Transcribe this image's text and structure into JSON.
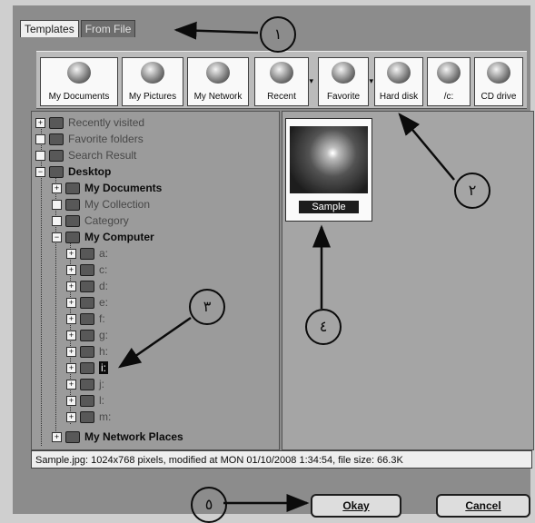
{
  "tabs": [
    {
      "label": "Templates"
    },
    {
      "label": "From File"
    }
  ],
  "toolbar": [
    {
      "label": "My Documents",
      "icon": "folder-documents-icon"
    },
    {
      "label": "My Pictures",
      "icon": "folder-pictures-icon"
    },
    {
      "label": "My Network",
      "icon": "network-icon"
    },
    {
      "label": "Recent",
      "icon": "recent-icon",
      "dropdown": "▾"
    },
    {
      "label": "Favorite",
      "icon": "favorite-icon",
      "dropdown": "▾"
    },
    {
      "label": "Hard disk",
      "icon": "hard-disk-icon"
    },
    {
      "label": "/c:",
      "icon": "drive-icon"
    },
    {
      "label": "CD drive",
      "icon": "cd-drive-icon"
    }
  ],
  "tree": [
    {
      "label": "Recently visited",
      "expander": "+",
      "style": "dim"
    },
    {
      "label": "Favorite folders",
      "expander": "",
      "style": "dim"
    },
    {
      "label": "Search Result",
      "expander": "",
      "style": "dim"
    },
    {
      "label": "Desktop",
      "expander": "−",
      "style": "bold"
    },
    {
      "label": "My Documents",
      "expander": "+",
      "style": "bold"
    },
    {
      "label": "My Collection",
      "expander": "",
      "style": "dim"
    },
    {
      "label": "Category",
      "expander": "",
      "style": "dim"
    },
    {
      "label": "My Computer",
      "expander": "−",
      "style": "bold"
    },
    {
      "label": "a:",
      "expander": "+",
      "style": "dim"
    },
    {
      "label": "c:",
      "expander": "+",
      "style": "dim"
    },
    {
      "label": "d:",
      "expander": "+",
      "style": "dim"
    },
    {
      "label": "e:",
      "expander": "+",
      "style": "dim"
    },
    {
      "label": "f:",
      "expander": "+",
      "style": "dim"
    },
    {
      "label": "g:",
      "expander": "+",
      "style": "dim"
    },
    {
      "label": "h:",
      "expander": "+",
      "style": "dim"
    },
    {
      "label": "i:",
      "expander": "+",
      "style": "selected"
    },
    {
      "label": "j:",
      "expander": "+",
      "style": "dim"
    },
    {
      "label": "l:",
      "expander": "+",
      "style": "dim"
    },
    {
      "label": "m:",
      "expander": "+",
      "style": "dim"
    },
    {
      "label": "My Network Places",
      "expander": "+",
      "style": "bold"
    }
  ],
  "preview": {
    "caption": "Sample"
  },
  "status_text": "Sample.jpg: 1024x768 pixels, modified at MON 01/10/2008 1:34:54, file size: 66.3K",
  "buttons": {
    "ok": "Okay",
    "cancel": "Cancel"
  },
  "callouts": [
    "١",
    "٢",
    "٣",
    "٤",
    "٥"
  ]
}
